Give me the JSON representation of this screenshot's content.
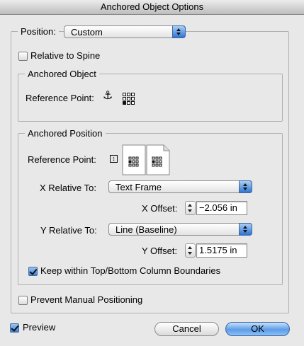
{
  "window": {
    "title": "Anchored Object Options"
  },
  "position": {
    "label": "Position:",
    "value": "Custom"
  },
  "relative_to_spine": {
    "label": "Relative to Spine",
    "checked": false
  },
  "anchored_object": {
    "title": "Anchored Object",
    "reference_point_label": "Reference Point:"
  },
  "anchored_position": {
    "title": "Anchored Position",
    "reference_point_label": "Reference Point:",
    "x_relative_label": "X Relative To:",
    "x_relative_value": "Text Frame",
    "x_offset_label": "X Offset:",
    "x_offset_value": "−2.056 in",
    "y_relative_label": "Y Relative To:",
    "y_relative_value": "Line (Baseline)",
    "y_offset_label": "Y Offset:",
    "y_offset_value": "1.5175 in",
    "keep_within_label": "Keep within Top/Bottom Column Boundaries",
    "keep_within_checked": true
  },
  "prevent_manual": {
    "label": "Prevent Manual Positioning",
    "checked": false
  },
  "preview": {
    "label": "Preview",
    "checked": true
  },
  "buttons": {
    "cancel": "Cancel",
    "ok": "OK"
  },
  "colors": {
    "accent": "#3f7fd0",
    "background": "#e8e8e8"
  }
}
